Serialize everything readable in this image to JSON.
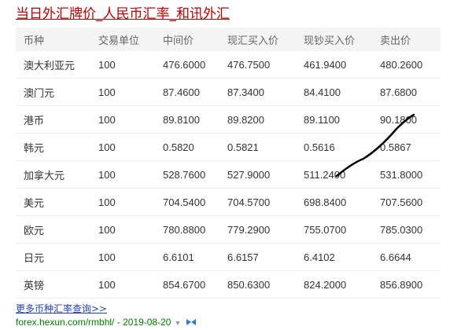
{
  "title": "当日外汇牌价_人民币汇率_和讯外汇",
  "table": {
    "headers": [
      "币种",
      "交易单位",
      "中间价",
      "现汇买入价",
      "现钞买入价",
      "卖出价"
    ],
    "rows": [
      [
        "澳大利亚元",
        "100",
        "476.6000",
        "476.7500",
        "461.9400",
        "480.2600"
      ],
      [
        "澳门元",
        "100",
        "87.4600",
        "87.3400",
        "84.4100",
        "87.6800"
      ],
      [
        "港币",
        "100",
        "89.8100",
        "89.8200",
        "89.1100",
        "90.1800"
      ],
      [
        "韩元",
        "100",
        "0.5820",
        "0.5821",
        "0.5616",
        "0.5867"
      ],
      [
        "加拿大元",
        "100",
        "528.7600",
        "527.9000",
        "511.2400",
        "531.8000"
      ],
      [
        "美元",
        "100",
        "704.5400",
        "704.5700",
        "698.8400",
        "707.5600"
      ],
      [
        "欧元",
        "100",
        "780.8800",
        "779.2900",
        "755.0700",
        "785.0300"
      ],
      [
        "日元",
        "100",
        "6.6101",
        "6.6157",
        "6.4102",
        "6.6644"
      ],
      [
        "英镑",
        "100",
        "854.6700",
        "850.6300",
        "824.2000",
        "856.8900"
      ]
    ]
  },
  "more_link": "更多币种汇率查询>>",
  "source": {
    "url": "forex.hexun.com/rmbhl/",
    "separator": " - ",
    "date": "2019-08-20"
  },
  "colors": {
    "title": "#c00000",
    "link": "#2440b3",
    "source_green": "#008000",
    "header_bg": "#f4f4f4",
    "pen_stroke": "#000000"
  },
  "icons": {
    "caret": "caret-down-icon",
    "snapshot": "snapshot-icon"
  }
}
